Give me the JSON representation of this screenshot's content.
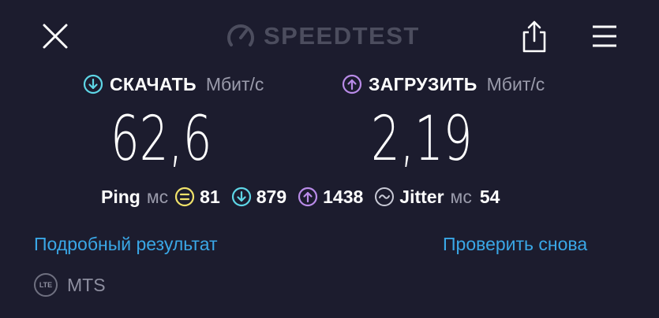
{
  "header": {
    "logo_text": "SPEEDTEST",
    "close_icon": "close-icon",
    "share_icon": "share-icon",
    "menu_icon": "menu-icon"
  },
  "download": {
    "label": "СКАЧАТЬ",
    "unit": "Мбит/с",
    "value": "62,6",
    "color": "#5ed6e6"
  },
  "upload": {
    "label": "ЗАГРУЗИТЬ",
    "unit": "Мбит/с",
    "value": "2,19",
    "color": "#b98be8"
  },
  "ping": {
    "label": "Ping",
    "unit": "мс",
    "idle": "81",
    "download": "879",
    "upload": "1438",
    "idle_color": "#f0e26a"
  },
  "jitter": {
    "label": "Jitter",
    "unit": "мс",
    "value": "54"
  },
  "links": {
    "detail": "Подробный результат",
    "retry": "Проверить снова",
    "color": "#3aa7e6"
  },
  "provider": {
    "badge": "LTE",
    "name": "MTS"
  }
}
